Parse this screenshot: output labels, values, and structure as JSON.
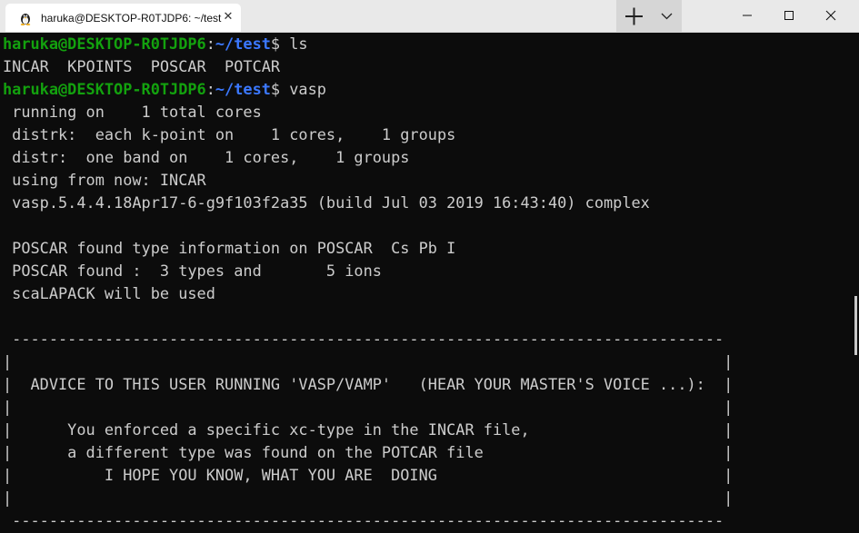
{
  "window": {
    "tab_title": "haruka@DESKTOP-R0TJDP6: ~/test",
    "tab_icon": "linux-penguin-icon",
    "new_tab_icon": "plus-icon",
    "dropdown_icon": "chevron-down-icon",
    "minimize_icon": "minimize-icon",
    "maximize_icon": "maximize-icon",
    "close_icon": "close-icon"
  },
  "colors": {
    "background": "#0c0c0c",
    "text": "#cccccc",
    "prompt_user": "#13a10e",
    "prompt_path": "#3b78ff",
    "titlebar": "#e9e9e9"
  },
  "terminal": {
    "prompt1": {
      "user": "haruka@DESKTOP-R0TJDP6",
      "colon": ":",
      "path": "~/test",
      "dollar": "$",
      "command": " ls"
    },
    "ls_output": "INCAR  KPOINTS  POSCAR  POTCAR",
    "prompt2": {
      "user": "haruka@DESKTOP-R0TJDP6",
      "colon": ":",
      "path": "~/test",
      "dollar": "$",
      "command": " vasp"
    },
    "output": [
      " running on    1 total cores",
      " distrk:  each k-point on    1 cores,    1 groups",
      " distr:  one band on    1 cores,    1 groups",
      " using from now: INCAR",
      " vasp.5.4.4.18Apr17-6-g9f103f2a35 (build Jul 03 2019 16:43:40) complex",
      "",
      " POSCAR found type information on POSCAR  Cs Pb I",
      " POSCAR found :  3 types and       5 ions",
      " scaLAPACK will be used",
      "",
      " -----------------------------------------------------------------------------",
      "|                                                                             |",
      "|  ADVICE TO THIS USER RUNNING 'VASP/VAMP'   (HEAR YOUR MASTER'S VOICE ...):  |",
      "|                                                                             |",
      "|      You enforced a specific xc-type in the INCAR file,                     |",
      "|      a different type was found on the POTCAR file                          |",
      "|          I HOPE YOU KNOW, WHAT YOU ARE  DOING                               |",
      "|                                                                             |",
      " -----------------------------------------------------------------------------"
    ]
  }
}
